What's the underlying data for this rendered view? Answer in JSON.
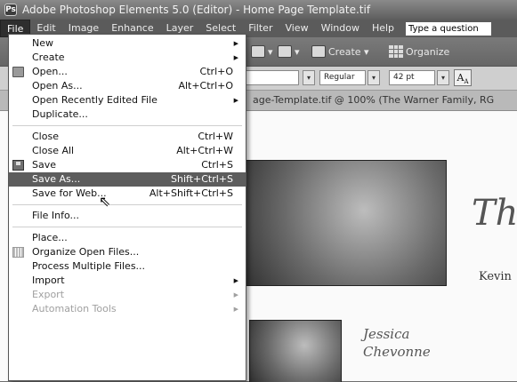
{
  "window": {
    "title": "Adobe Photoshop Elements 5.0 (Editor) - Home Page Template.tif",
    "app_icon": "ps-elements-icon"
  },
  "menubar": {
    "items": [
      "File",
      "Edit",
      "Image",
      "Enhance",
      "Layer",
      "Select",
      "Filter",
      "View",
      "Window",
      "Help"
    ],
    "help_placeholder": "Type a question"
  },
  "toolbar": {
    "create_label": "Create",
    "organize_label": "Organize"
  },
  "options": {
    "font_style": "Regular",
    "font_size": "42 pt"
  },
  "document": {
    "tab_title": "age-Template.tif @ 100% (The Warner Family, RG"
  },
  "canvas": {
    "script_big": "Th",
    "name_text": "Kevin",
    "jessica": "Jessica",
    "chevonne": "Chevonne"
  },
  "file_menu": {
    "items": [
      {
        "label": "New",
        "shortcut": "",
        "submenu": true
      },
      {
        "label": "Create",
        "shortcut": "",
        "submenu": true
      },
      {
        "label": "Open...",
        "shortcut": "Ctrl+O",
        "icon": "open-folder-icon"
      },
      {
        "label": "Open As...",
        "shortcut": "Alt+Ctrl+O"
      },
      {
        "label": "Open Recently Edited File",
        "shortcut": "",
        "submenu": true
      },
      {
        "label": "Duplicate...",
        "shortcut": ""
      },
      {
        "label": "Close",
        "shortcut": "Ctrl+W"
      },
      {
        "label": "Close All",
        "shortcut": "Alt+Ctrl+W"
      },
      {
        "label": "Save",
        "shortcut": "Ctrl+S",
        "icon": "save-disk-icon"
      },
      {
        "label": "Save As...",
        "shortcut": "Shift+Ctrl+S",
        "highlighted": true
      },
      {
        "label": "Save for Web...",
        "shortcut": "Alt+Shift+Ctrl+S"
      },
      {
        "label": "File Info...",
        "shortcut": ""
      },
      {
        "label": "Place...",
        "shortcut": ""
      },
      {
        "label": "Organize Open Files...",
        "shortcut": "",
        "icon": "organize-icon"
      },
      {
        "label": "Process Multiple Files...",
        "shortcut": ""
      },
      {
        "label": "Import",
        "shortcut": "",
        "submenu": true
      },
      {
        "label": "Export",
        "shortcut": "",
        "submenu": true,
        "disabled": true
      },
      {
        "label": "Automation Tools",
        "shortcut": "",
        "submenu": true,
        "disabled": true
      }
    ]
  }
}
